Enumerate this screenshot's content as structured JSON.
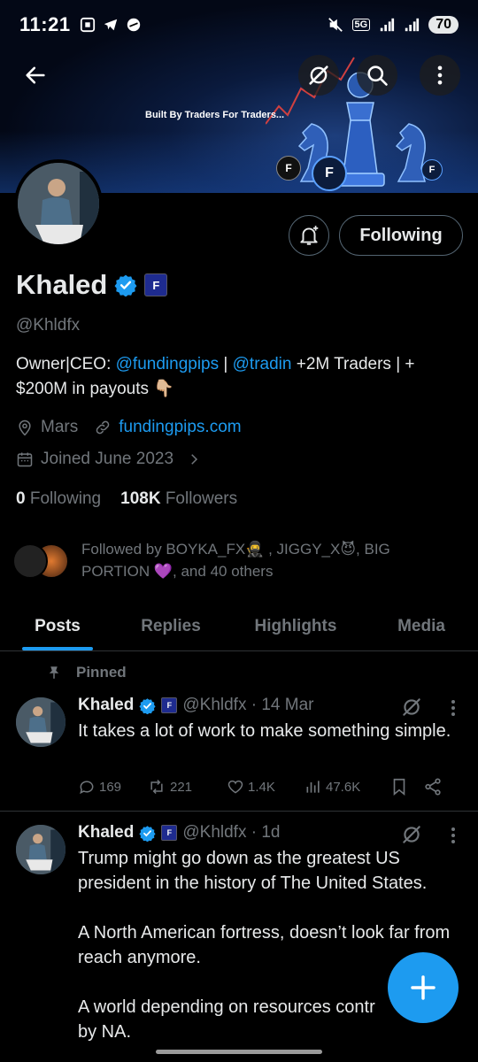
{
  "status_bar": {
    "time": "11:21",
    "network": "5G",
    "battery": "70"
  },
  "banner": {
    "tagline": "Built By Traders For Traders..."
  },
  "header": {
    "following_label": "Following"
  },
  "profile": {
    "name": "Khaled",
    "affiliate_badge": "F",
    "handle": "@Khldfx",
    "bio_prefix": "Owner|CEO: ",
    "bio_link1": "@fundingpips",
    "bio_sep": " | ",
    "bio_link2": "@tradin",
    "bio_suffix": "  +2M Traders | + $200M in payouts 👇🏼",
    "location": "Mars",
    "website": "fundingpips.com",
    "joined": "Joined June 2023",
    "following_count": "0",
    "following_label": "Following",
    "followers_count": "108K",
    "followers_label": "Followers",
    "followed_by": "Followed by BOYKA_FX🥷 , JIGGY_X😈, BIG PORTION 💜, and 40 others"
  },
  "tabs": [
    {
      "label": "Posts",
      "active": true
    },
    {
      "label": "Replies",
      "active": false
    },
    {
      "label": "Highlights",
      "active": false
    },
    {
      "label": "Media",
      "active": false
    }
  ],
  "pinned_label": "Pinned",
  "posts": [
    {
      "name": "Khaled",
      "handle_time": "@Khldfx · 14 Mar",
      "text": "It takes a lot of work to make something simple.",
      "replies": "169",
      "reposts": "221",
      "likes": "1.4K",
      "views": "47.6K"
    },
    {
      "name": "Khaled",
      "handle_time": "@Khldfx · 1d",
      "text": "Trump might go down as the greatest US president in the history of The United States.\n\nA North American fortress, doesn’t look far from reach anymore.\n\nA world depending on resources contr\nby NA."
    }
  ],
  "colors": {
    "accent": "#1d9bf0",
    "muted": "#71767b",
    "text": "#e7e9ea",
    "divider": "#2f3336"
  }
}
